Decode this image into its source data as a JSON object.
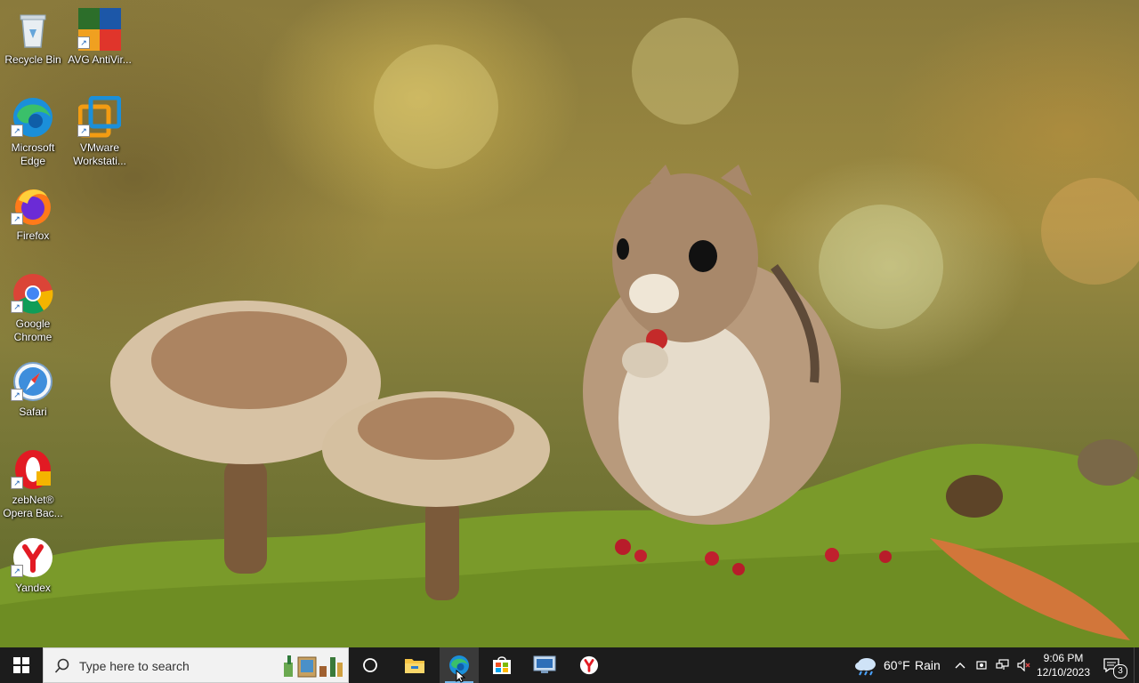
{
  "desktop": {
    "icons": [
      {
        "label": "Recycle Bin",
        "icon": "recycle-bin-icon"
      },
      {
        "label": "AVG AntiVir...",
        "icon": "avg-antivirus-icon"
      },
      {
        "label": "Microsoft Edge",
        "icon": "edge-icon"
      },
      {
        "label": "VMware Workstati...",
        "icon": "vmware-icon"
      },
      {
        "label": "Firefox",
        "icon": "firefox-icon"
      },
      {
        "label": "Google Chrome",
        "icon": "chrome-icon"
      },
      {
        "label": "Safari",
        "icon": "safari-icon"
      },
      {
        "label": "zebNet® Opera Bac...",
        "icon": "opera-backup-icon"
      },
      {
        "label": "Yandex",
        "icon": "yandex-icon"
      }
    ],
    "wallpaper": "chipmunk-mushrooms-moss"
  },
  "taskbar": {
    "search_placeholder": "Type here to search",
    "pinned": [
      "task-view-icon",
      "file-explorer-icon",
      "edge-icon",
      "microsoft-store-icon",
      "remote-desktop-icon",
      "yandex-icon"
    ],
    "weather": {
      "temp": "60°F",
      "condition": "Rain"
    },
    "clock": {
      "time": "9:06 PM",
      "date": "12/10/2023"
    },
    "notifications_count": "3"
  },
  "colors": {
    "taskbar_bg": "#1c1c1c",
    "accent": "#0078d4"
  }
}
